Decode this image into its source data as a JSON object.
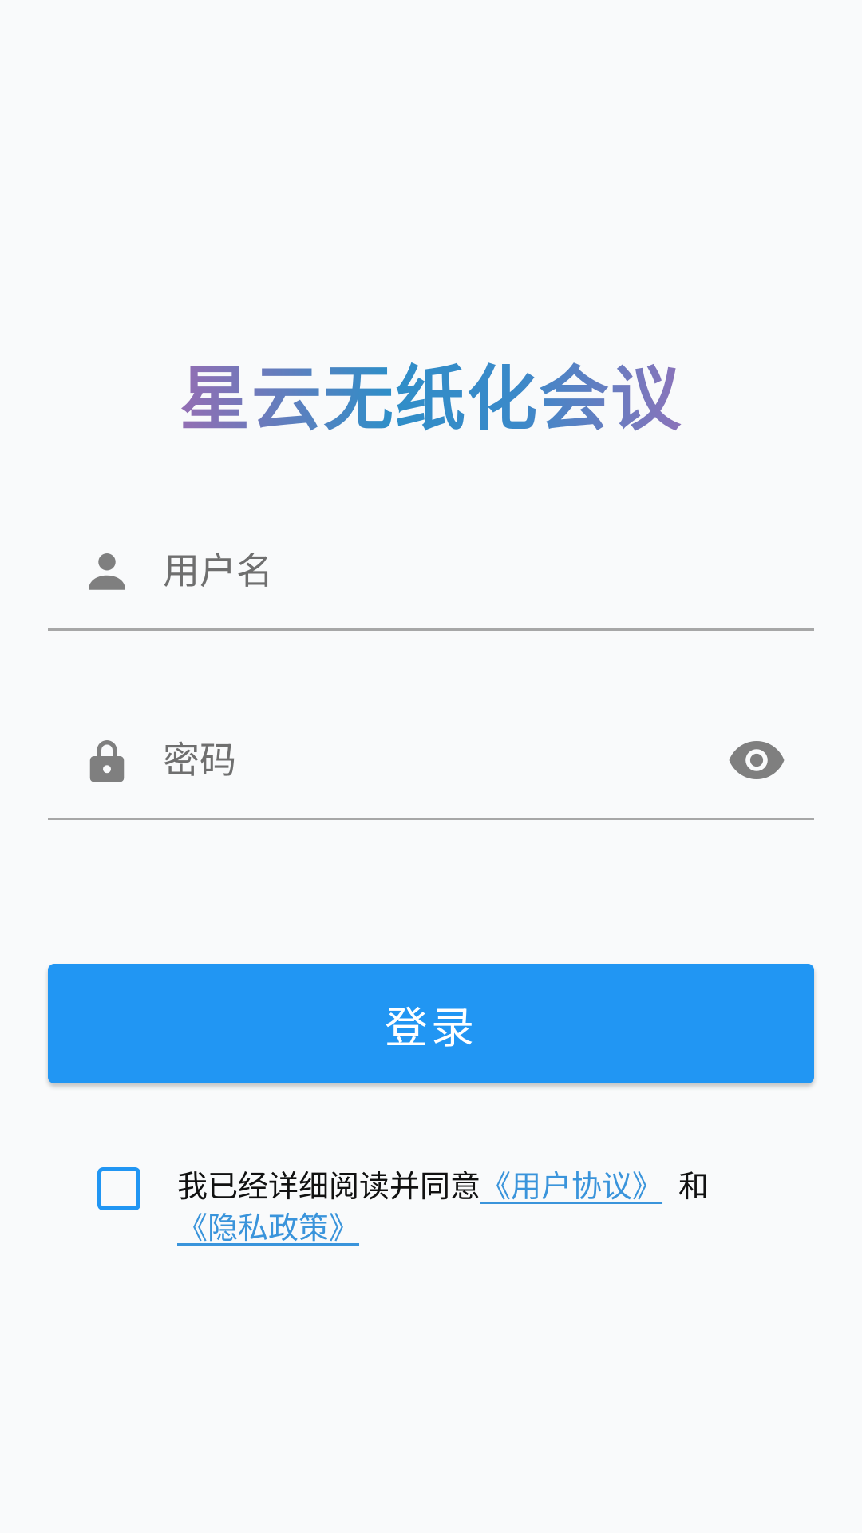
{
  "app": {
    "title": "星云无纸化会议"
  },
  "form": {
    "username": {
      "placeholder": "用户名",
      "value": "",
      "icon": "person-icon"
    },
    "password": {
      "placeholder": "密码",
      "value": "",
      "icon": "lock-icon",
      "toggle_icon": "eye-icon"
    },
    "login_label": "登录"
  },
  "agreement": {
    "checked": false,
    "prefix": "我已经详细阅读并同意",
    "user_agreement": "《用户协议》",
    "and_text": "和",
    "privacy_policy": "《隐私政策》"
  },
  "colors": {
    "background": "#f9fafb",
    "accent": "#2196f3",
    "link": "#3a94db",
    "icon": "#7f7f7f",
    "divider": "#a7a7a7"
  }
}
